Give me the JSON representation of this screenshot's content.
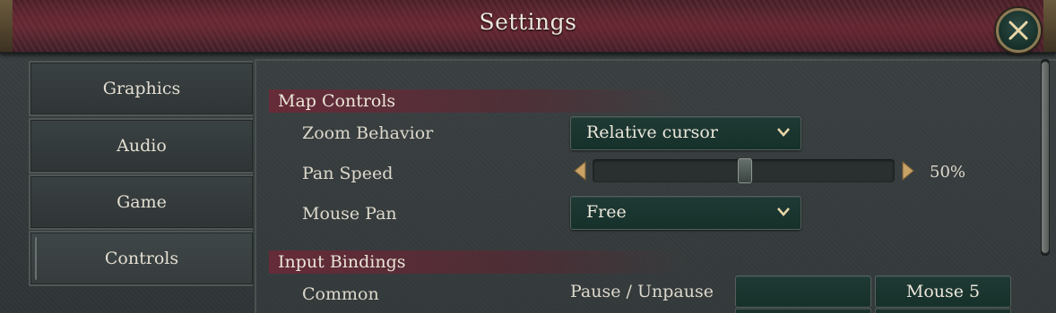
{
  "window": {
    "title": "Settings"
  },
  "close_button": {
    "icon": "close-icon"
  },
  "tabs": [
    {
      "label": "Graphics"
    },
    {
      "label": "Audio"
    },
    {
      "label": "Game"
    },
    {
      "label": "Controls",
      "selected": true
    }
  ],
  "sections": {
    "map_controls": {
      "title": "Map Controls",
      "zoom_behavior": {
        "label": "Zoom Behavior",
        "value": "Relative cursor"
      },
      "pan_speed": {
        "label": "Pan Speed",
        "value_text": "50%",
        "value": 0.5
      },
      "mouse_pan": {
        "label": "Mouse Pan",
        "value": "Free"
      }
    },
    "input_bindings": {
      "title": "Input Bindings",
      "category": "Common",
      "rows": [
        {
          "action": "Pause / Unpause",
          "primary": "",
          "secondary": "Mouse 5"
        }
      ]
    }
  },
  "colors": {
    "title_bar": "#5e2a33",
    "panel_bg": "#3a4041",
    "dropdown_bg": "#1f3a34",
    "section_header": "#6e2837",
    "frame_gold": "#8c7a55"
  }
}
